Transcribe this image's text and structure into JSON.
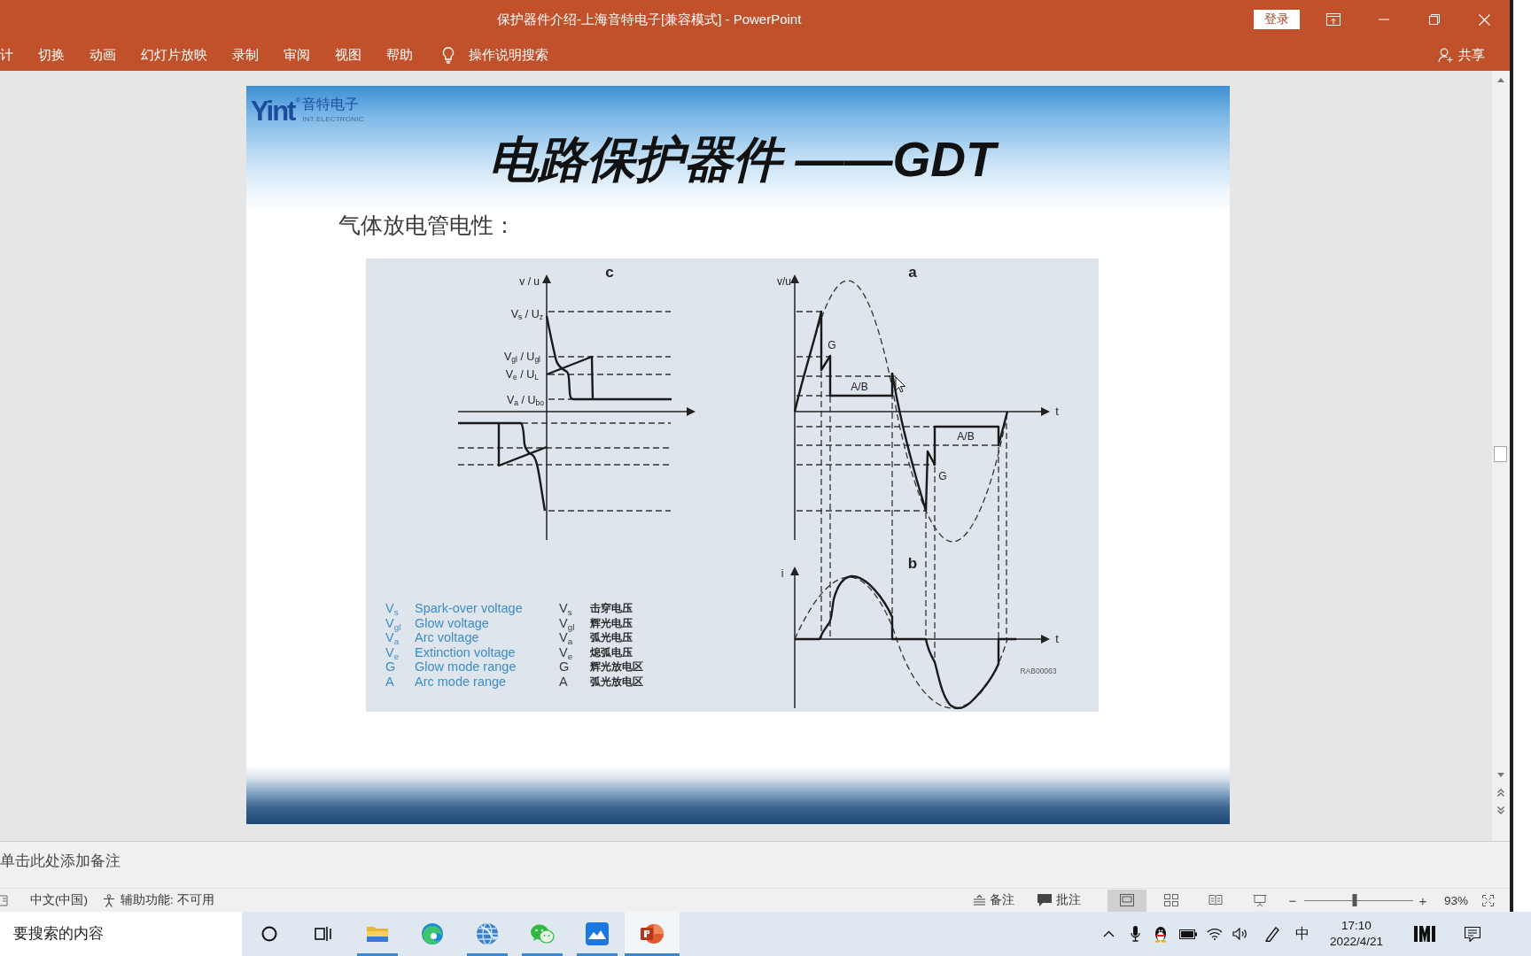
{
  "window": {
    "title": "保护器件介绍-上海音特电子[兼容模式] - PowerPoint",
    "sign_in": "登录"
  },
  "ribbon": {
    "tabs": [
      {
        "label": "计",
        "selected": false
      },
      {
        "label": "切换",
        "selected": false
      },
      {
        "label": "动画",
        "selected": false
      },
      {
        "label": "幻灯片放映",
        "selected": false
      },
      {
        "label": "录制",
        "selected": false
      },
      {
        "label": "审阅",
        "selected": false
      },
      {
        "label": "视图",
        "selected": false
      },
      {
        "label": "帮助",
        "selected": false
      }
    ],
    "search": "操作说明搜索",
    "share": "共享"
  },
  "slide": {
    "logo": {
      "mark": "Yint",
      "registered": "®",
      "name": "音特电子",
      "tagline": "INT ELECTRONIC"
    },
    "title": "电路保护器件 ——GDT",
    "subtitle": "气体放电管电性：",
    "figure": {
      "panel_c": {
        "label": "c",
        "y_axis": "v / u",
        "levels": [
          "V$_{s}$ / U$_{z}$",
          "V$_{gl}$ / U$_{gl}$",
          "V$_{e}$ / U$_{L}$",
          "V$_{a}$ / U$_{bo}$"
        ]
      },
      "panel_a": {
        "label": "a",
        "y_axis": "v/u",
        "x_axis": "t",
        "regions": [
          "G",
          "A/B",
          "A/B",
          "G"
        ]
      },
      "panel_b": {
        "label": "b",
        "y_axis": "i",
        "x_axis": "t"
      },
      "code": "RAB00063",
      "legend_en": [
        {
          "symbol": "V$_{s}$",
          "text": "Spark-over voltage"
        },
        {
          "symbol": "V$_{gl}$",
          "text": "Glow voltage"
        },
        {
          "symbol": "V$_{a}$",
          "text": "Arc voltage"
        },
        {
          "symbol": "V$_{e}$",
          "text": "Extinction voltage"
        },
        {
          "symbol": "G",
          "text": "Glow mode range"
        },
        {
          "symbol": "A",
          "text": "Arc mode range"
        }
      ],
      "legend_zh": [
        {
          "symbol": "V$_{s}$",
          "text": "击穿电压"
        },
        {
          "symbol": "V$_{gl}$",
          "text": "辉光电压"
        },
        {
          "symbol": "V$_{a}$",
          "text": "弧光电压"
        },
        {
          "symbol": "V$_{e}$",
          "text": "熄弧电压"
        },
        {
          "symbol": "G",
          "text": "辉光放电区"
        },
        {
          "symbol": "A",
          "text": "弧光放电区"
        }
      ]
    }
  },
  "notes": {
    "placeholder": "单击此处添加备注"
  },
  "status_bar": {
    "language": "中文(中国)",
    "accessibility": "辅助功能: 不可用",
    "notes": "备注",
    "comments": "批注",
    "views": [
      {
        "kind": "normal",
        "selected": true
      },
      {
        "kind": "sorter",
        "selected": false
      },
      {
        "kind": "reading",
        "selected": false
      },
      {
        "kind": "slideshow",
        "selected": false
      }
    ],
    "zoom": {
      "zoom_out": "−",
      "zoom_in": "+",
      "level": 0.46,
      "reading": "93%"
    }
  },
  "taskbar": {
    "search": {
      "placeholder": "要搜索的内容"
    },
    "apps": [
      {
        "kind": "explorer",
        "running": true,
        "selected": false
      },
      {
        "kind": "edge",
        "running": false,
        "selected": false
      },
      {
        "kind": "globe",
        "running": true,
        "selected": false
      },
      {
        "kind": "wechat",
        "running": true,
        "selected": false
      },
      {
        "kind": "mountain",
        "running": true,
        "selected": false
      },
      {
        "kind": "powerpoint",
        "running": true,
        "selected": true
      }
    ],
    "ime": "中",
    "time": "17:10",
    "date": "2022/4/21"
  }
}
